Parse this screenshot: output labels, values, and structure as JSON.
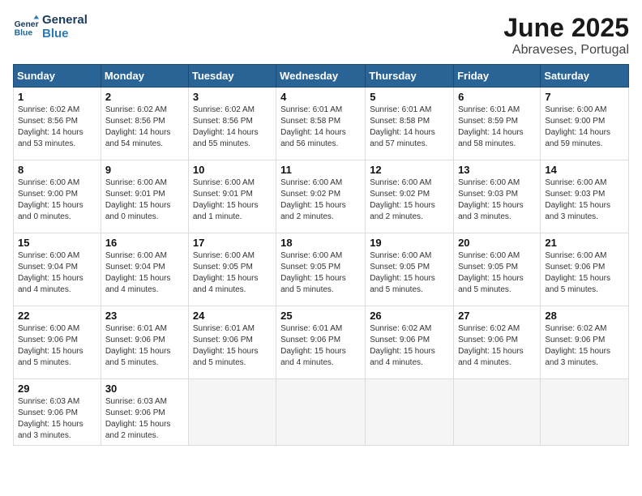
{
  "header": {
    "logo_line1": "General",
    "logo_line2": "Blue",
    "month": "June 2025",
    "location": "Abraveses, Portugal"
  },
  "weekdays": [
    "Sunday",
    "Monday",
    "Tuesday",
    "Wednesday",
    "Thursday",
    "Friday",
    "Saturday"
  ],
  "weeks": [
    [
      {
        "day": "1",
        "info": "Sunrise: 6:02 AM\nSunset: 8:56 PM\nDaylight: 14 hours\nand 53 minutes."
      },
      {
        "day": "2",
        "info": "Sunrise: 6:02 AM\nSunset: 8:56 PM\nDaylight: 14 hours\nand 54 minutes."
      },
      {
        "day": "3",
        "info": "Sunrise: 6:02 AM\nSunset: 8:56 PM\nDaylight: 14 hours\nand 55 minutes."
      },
      {
        "day": "4",
        "info": "Sunrise: 6:01 AM\nSunset: 8:58 PM\nDaylight: 14 hours\nand 56 minutes."
      },
      {
        "day": "5",
        "info": "Sunrise: 6:01 AM\nSunset: 8:58 PM\nDaylight: 14 hours\nand 57 minutes."
      },
      {
        "day": "6",
        "info": "Sunrise: 6:01 AM\nSunset: 8:59 PM\nDaylight: 14 hours\nand 58 minutes."
      },
      {
        "day": "7",
        "info": "Sunrise: 6:00 AM\nSunset: 9:00 PM\nDaylight: 14 hours\nand 59 minutes."
      }
    ],
    [
      {
        "day": "8",
        "info": "Sunrise: 6:00 AM\nSunset: 9:00 PM\nDaylight: 15 hours\nand 0 minutes."
      },
      {
        "day": "9",
        "info": "Sunrise: 6:00 AM\nSunset: 9:01 PM\nDaylight: 15 hours\nand 0 minutes."
      },
      {
        "day": "10",
        "info": "Sunrise: 6:00 AM\nSunset: 9:01 PM\nDaylight: 15 hours\nand 1 minute."
      },
      {
        "day": "11",
        "info": "Sunrise: 6:00 AM\nSunset: 9:02 PM\nDaylight: 15 hours\nand 2 minutes."
      },
      {
        "day": "12",
        "info": "Sunrise: 6:00 AM\nSunset: 9:02 PM\nDaylight: 15 hours\nand 2 minutes."
      },
      {
        "day": "13",
        "info": "Sunrise: 6:00 AM\nSunset: 9:03 PM\nDaylight: 15 hours\nand 3 minutes."
      },
      {
        "day": "14",
        "info": "Sunrise: 6:00 AM\nSunset: 9:03 PM\nDaylight: 15 hours\nand 3 minutes."
      }
    ],
    [
      {
        "day": "15",
        "info": "Sunrise: 6:00 AM\nSunset: 9:04 PM\nDaylight: 15 hours\nand 4 minutes."
      },
      {
        "day": "16",
        "info": "Sunrise: 6:00 AM\nSunset: 9:04 PM\nDaylight: 15 hours\nand 4 minutes."
      },
      {
        "day": "17",
        "info": "Sunrise: 6:00 AM\nSunset: 9:05 PM\nDaylight: 15 hours\nand 4 minutes."
      },
      {
        "day": "18",
        "info": "Sunrise: 6:00 AM\nSunset: 9:05 PM\nDaylight: 15 hours\nand 5 minutes."
      },
      {
        "day": "19",
        "info": "Sunrise: 6:00 AM\nSunset: 9:05 PM\nDaylight: 15 hours\nand 5 minutes."
      },
      {
        "day": "20",
        "info": "Sunrise: 6:00 AM\nSunset: 9:05 PM\nDaylight: 15 hours\nand 5 minutes."
      },
      {
        "day": "21",
        "info": "Sunrise: 6:00 AM\nSunset: 9:06 PM\nDaylight: 15 hours\nand 5 minutes."
      }
    ],
    [
      {
        "day": "22",
        "info": "Sunrise: 6:00 AM\nSunset: 9:06 PM\nDaylight: 15 hours\nand 5 minutes."
      },
      {
        "day": "23",
        "info": "Sunrise: 6:01 AM\nSunset: 9:06 PM\nDaylight: 15 hours\nand 5 minutes."
      },
      {
        "day": "24",
        "info": "Sunrise: 6:01 AM\nSunset: 9:06 PM\nDaylight: 15 hours\nand 5 minutes."
      },
      {
        "day": "25",
        "info": "Sunrise: 6:01 AM\nSunset: 9:06 PM\nDaylight: 15 hours\nand 4 minutes."
      },
      {
        "day": "26",
        "info": "Sunrise: 6:02 AM\nSunset: 9:06 PM\nDaylight: 15 hours\nand 4 minutes."
      },
      {
        "day": "27",
        "info": "Sunrise: 6:02 AM\nSunset: 9:06 PM\nDaylight: 15 hours\nand 4 minutes."
      },
      {
        "day": "28",
        "info": "Sunrise: 6:02 AM\nSunset: 9:06 PM\nDaylight: 15 hours\nand 3 minutes."
      }
    ],
    [
      {
        "day": "29",
        "info": "Sunrise: 6:03 AM\nSunset: 9:06 PM\nDaylight: 15 hours\nand 3 minutes."
      },
      {
        "day": "30",
        "info": "Sunrise: 6:03 AM\nSunset: 9:06 PM\nDaylight: 15 hours\nand 2 minutes."
      },
      null,
      null,
      null,
      null,
      null
    ]
  ]
}
